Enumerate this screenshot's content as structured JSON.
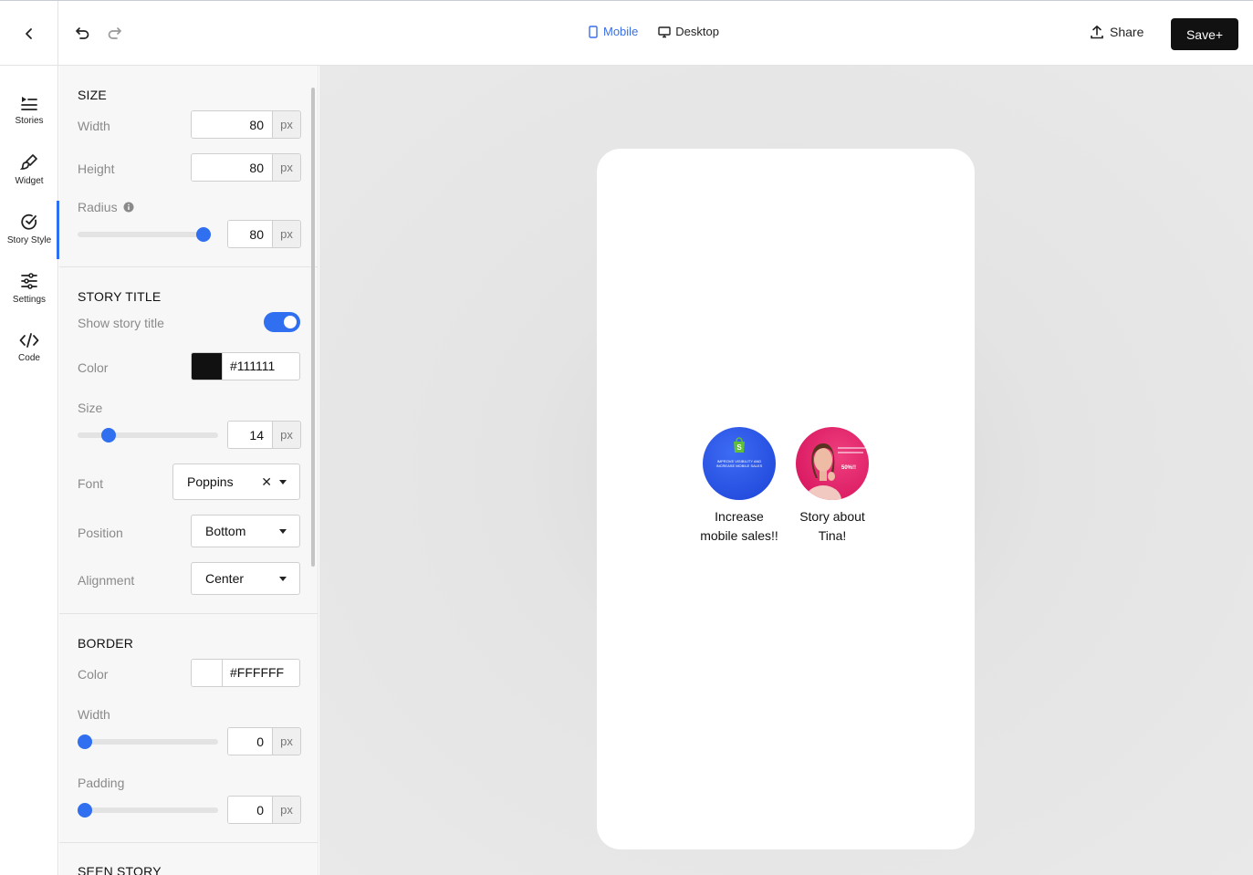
{
  "header": {
    "device_tabs": [
      {
        "label": "Mobile",
        "active": true
      },
      {
        "label": "Desktop",
        "active": false
      }
    ],
    "share_label": "Share",
    "save_label": "Save+"
  },
  "rail": {
    "items": [
      {
        "label": "Stories",
        "icon": "stories-icon"
      },
      {
        "label": "Widget",
        "icon": "brush-icon"
      },
      {
        "label": "Story Style",
        "icon": "check-circle-icon",
        "active": true
      },
      {
        "label": "Settings",
        "icon": "sliders-icon"
      },
      {
        "label": "Code",
        "icon": "code-icon"
      }
    ]
  },
  "size": {
    "title": "SIZE",
    "width_label": "Width",
    "width_value": "80",
    "height_label": "Height",
    "height_value": "80",
    "radius_label": "Radius",
    "radius_value": "80",
    "radius_level": 1.0,
    "unit": "px"
  },
  "story_title": {
    "title": "STORY TITLE",
    "show_label": "Show story title",
    "show_enabled": true,
    "color_label": "Color",
    "color_value": "#111111",
    "size_label": "Size",
    "size_value": "14",
    "size_level": 0.22,
    "font_label": "Font",
    "font_value": "Poppins",
    "font_clear": "✕",
    "position_label": "Position",
    "position_value": "Bottom",
    "alignment_label": "Alignment",
    "alignment_value": "Center",
    "unit": "px"
  },
  "border": {
    "title": "BORDER",
    "color_label": "Color",
    "color_value": "#FFFFFF",
    "width_label": "Width",
    "width_value": "0",
    "width_level": 0.0,
    "padding_label": "Padding",
    "padding_value": "0",
    "padding_level": 0.0,
    "unit": "px"
  },
  "seen_story": {
    "title": "SEEN STORY"
  },
  "preview": {
    "stories": [
      {
        "title": "Increase mobile sales!!",
        "thumb_text": "Improve VISIBILITY and INCREASE MOBILE SALES",
        "color": "#2352e6"
      },
      {
        "title": "Story about Tina!",
        "thumb_text": "50%!!",
        "color": "#e21463"
      }
    ]
  },
  "colors": {
    "accent": "#2f6ff0",
    "save_bg": "#111111"
  }
}
